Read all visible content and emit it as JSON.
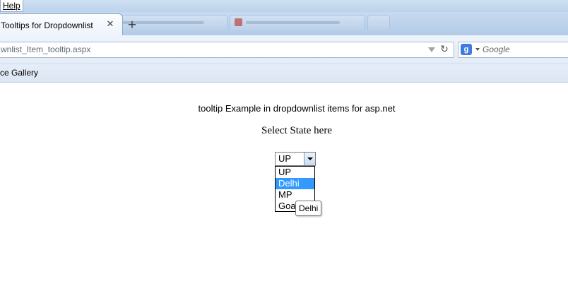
{
  "menubar": {
    "help_label": "Help"
  },
  "tabs": {
    "active_title": "Tooltips for Dropdownlist",
    "close_glyph": "✕",
    "new_tab_glyph": "+"
  },
  "navbar": {
    "url": "wnlist_Item_tooltip.aspx",
    "reload_glyph": "↻",
    "search_engine_glyph": "g",
    "search_placeholder": "Google"
  },
  "bookmarks": {
    "item_label": "ce Gallery"
  },
  "page": {
    "heading": "tooltip Example in dropdownlist items for asp.net",
    "select_label": "Select State here",
    "selected_value": "UP",
    "options": [
      "UP",
      "Delhi",
      "MP",
      "Goa"
    ],
    "highlighted_index": 1,
    "tooltip_text": "Delhi"
  },
  "colors": {
    "option_highlight": "#3399ff",
    "chrome_blue": "#c7daf0"
  }
}
